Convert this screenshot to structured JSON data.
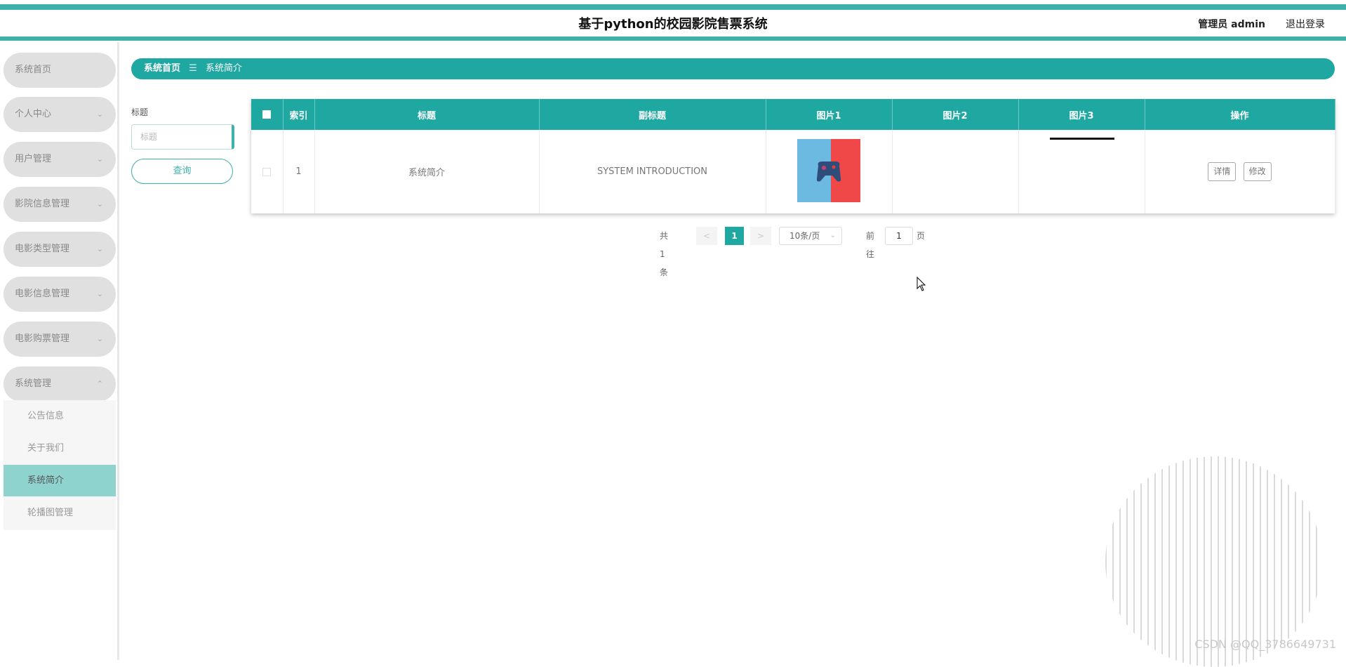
{
  "header": {
    "title": "基于python的校园影院售票系统",
    "user": "管理员 admin",
    "logout": "退出登录"
  },
  "sidebar": {
    "items": [
      {
        "label": "系统首页",
        "has_chevron": false
      },
      {
        "label": "个人中心",
        "has_chevron": true
      },
      {
        "label": "用户管理",
        "has_chevron": true
      },
      {
        "label": "影院信息管理",
        "has_chevron": true
      },
      {
        "label": "电影类型管理",
        "has_chevron": true
      },
      {
        "label": "电影信息管理",
        "has_chevron": true
      },
      {
        "label": "电影购票管理",
        "has_chevron": true
      },
      {
        "label": "系统管理",
        "has_chevron": true,
        "expanded": true
      }
    ],
    "sub_items": [
      {
        "label": "公告信息"
      },
      {
        "label": "关于我们"
      },
      {
        "label": "系统简介",
        "active": true
      },
      {
        "label": "轮播图管理"
      }
    ],
    "chevron_down": "⌄",
    "chevron_up": "⌃"
  },
  "breadcrumb": {
    "home": "系统首页",
    "separator": "☰",
    "current": "系统简介"
  },
  "search": {
    "label": "标题",
    "placeholder": "标题",
    "value": "",
    "button": "查询"
  },
  "table": {
    "columns": [
      "索引",
      "标题",
      "副标题",
      "图片1",
      "图片2",
      "图片3",
      "操作"
    ],
    "rows": [
      {
        "index": "1",
        "title": "系统简介",
        "subtitle": "SYSTEM INTRODUCTION",
        "image1": "gamepad-thumbnail",
        "image2": "",
        "image3": "line-thumbnail",
        "actions": [
          "详情",
          "修改"
        ]
      }
    ]
  },
  "pagination": {
    "total": "共 1 条",
    "prev": "<",
    "current_page": "1",
    "next": ">",
    "page_size": "10条/页",
    "goto_label": "前往",
    "goto_value": "1",
    "goto_unit": "页"
  },
  "watermark": "CSDN @QQ_3786649731",
  "colors": {
    "accent": "#1fa8a2",
    "header_bar": "#3fb0ab",
    "active_sub": "#8fd3cf"
  }
}
